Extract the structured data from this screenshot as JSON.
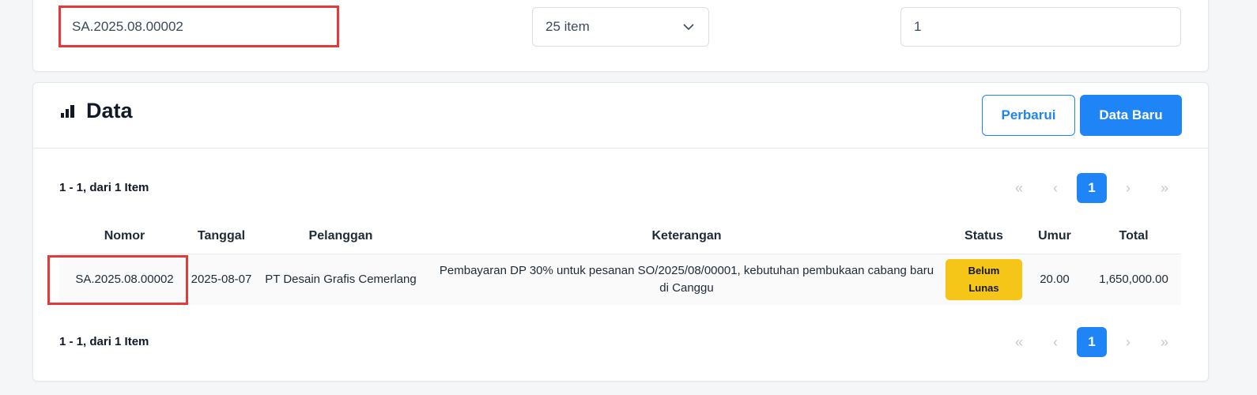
{
  "filters": {
    "search_value": "SA.2025.08.00002",
    "per_page_selected": "25 item",
    "page_value": "1"
  },
  "data_panel": {
    "title": "Data",
    "refresh_label": "Perbarui",
    "new_label": "Data Baru",
    "range_text_top": "1 - 1, dari 1 Item",
    "range_text_bottom": "1 - 1, dari 1 Item",
    "pagination": {
      "first": "«",
      "prev": "‹",
      "current": "1",
      "next": "›",
      "last": "»"
    }
  },
  "table": {
    "headers": [
      "Nomor",
      "Tanggal",
      "Pelanggan",
      "Keterangan",
      "Status",
      "Umur",
      "Total"
    ],
    "rows": [
      {
        "nomor": "SA.2025.08.00002",
        "tanggal": "2025-08-07",
        "pelanggan": "PT Desain Grafis Cemerlang",
        "keterangan": "Pembayaran DP 30% untuk pesanan SO/2025/08/00001, kebutuhan pembukaan cabang baru di Canggu",
        "status": "Belum Lunas",
        "umur": "20.00",
        "total": "1,650,000.00"
      }
    ]
  },
  "colors": {
    "primary": "#1f84f5",
    "highlight_border": "#e03a3a",
    "badge_warning": "#f5c518"
  },
  "icons": {
    "title_icon": "bar-chart-icon",
    "select_icon": "chevron-down-icon"
  }
}
